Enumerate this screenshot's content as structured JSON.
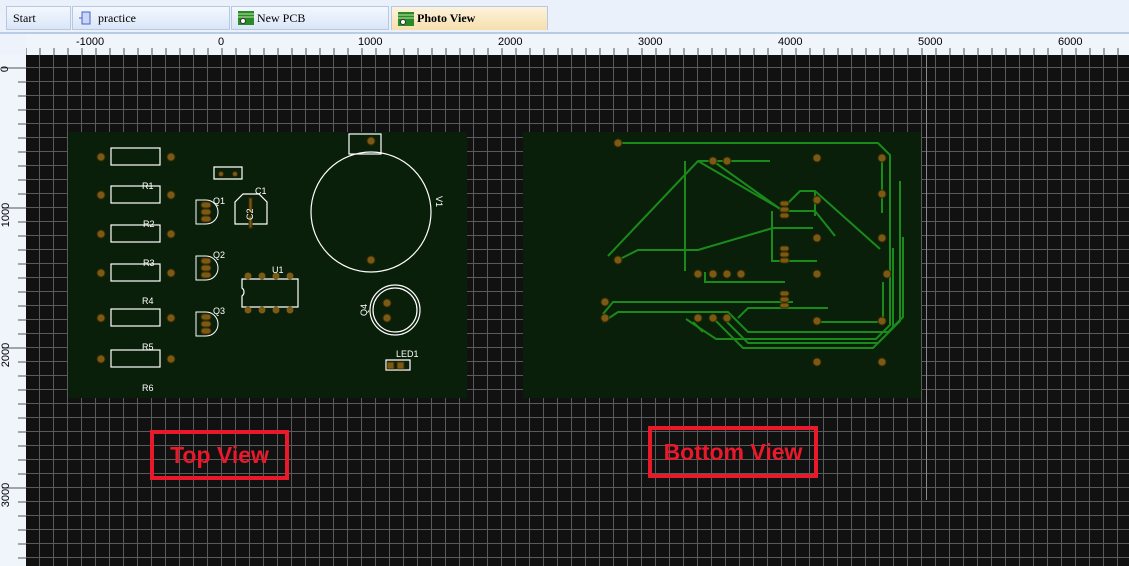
{
  "tabs": [
    {
      "label": "Start",
      "icon": "none"
    },
    {
      "label": "practice",
      "icon": "schematic-icon"
    },
    {
      "label": "New PCB",
      "icon": "pcb-icon"
    },
    {
      "label": "Photo View",
      "icon": "pcb-icon",
      "active": true
    }
  ],
  "ruler": {
    "horizontal": [
      "-1000",
      "0",
      "1000",
      "2000",
      "3000",
      "4000",
      "5000",
      "6000"
    ],
    "vertical": [
      "0",
      "1000",
      "2000",
      "3000"
    ]
  },
  "top_view": {
    "caption": "Top View",
    "designators": {
      "r1": "R1",
      "r2": "R2",
      "r3": "R3",
      "r4": "R4",
      "r5": "R5",
      "r6": "R6",
      "q1": "Q1",
      "q2": "Q2",
      "q3": "Q3",
      "q4": "Q4",
      "c1": "C1",
      "c2": "C2",
      "u1": "U1",
      "v1": "V1",
      "led1": "LED1"
    }
  },
  "bottom_view": {
    "caption": "Bottom View"
  },
  "colors": {
    "board": "#0a1f0a",
    "pad": "#7a5a14",
    "trace": "#1a8a1a",
    "silk": "#ffffff",
    "annotation": "#e8192a"
  }
}
